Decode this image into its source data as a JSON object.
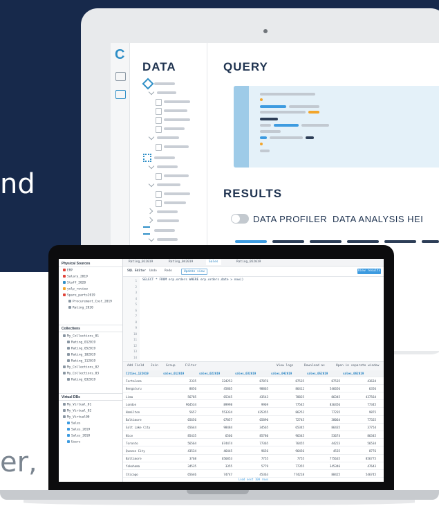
{
  "hero": {
    "left_fragment": "nd",
    "bottom_fragment": "er,"
  },
  "colors": {
    "navy": "#17294b",
    "accent": "#3d9be0",
    "orange": "#f2a52b",
    "teal": "#2f8fc7"
  },
  "tablet": {
    "logo": "C",
    "rail_icons": [
      "book-icon",
      "edit-icon"
    ],
    "data_heading": "DATA",
    "query_heading": "QUERY",
    "results_heading": "RESULTS",
    "data_profiler_label": "DATA PROFILER",
    "data_analysis_label": "DATA ANALYSIS HEI"
  },
  "app": {
    "sidebar": {
      "physical_title": "Physical Sources",
      "physical_items": [
        "ERP",
        "Salary_2019",
        "Staff_2020",
        "yelp_review",
        "Spare_parts2019",
        "Procurement_Cost_2019",
        "Rating_2020"
      ],
      "collections_title": "Collections",
      "collection_items": [
        "My_Collections_01",
        "Rating_012019",
        "Rating_052019",
        "Rating_102019",
        "Rating_112019",
        "My_Collections_02",
        "My_Collections_03",
        "Rating_032019"
      ],
      "virtual_title": "Virtual DBs",
      "virtual_items": [
        "My_Virtual_01",
        "My_Virtual_02",
        "My_Virtual00",
        "Sales",
        "Sales_2019",
        "Sales_2018",
        "Users"
      ]
    },
    "tabs": [
      "Rating_012019",
      "Rating_042019",
      "Sales",
      "Rating_052019"
    ],
    "toolbar": {
      "sql_editor": "SQL Editor",
      "undo": "Undo",
      "redo": "Redo",
      "update_view": "Update view",
      "run": "View results"
    },
    "code": "SELECT * FROM erp.orders WHERE erp.orders.date > now()",
    "line_numbers": [
      "1",
      "2",
      "3",
      "4",
      "5",
      "6",
      "7",
      "8",
      "9",
      "10",
      "11",
      "12",
      "13",
      "14"
    ],
    "results_toolbar": {
      "add_field": "Add Field",
      "join": "Join",
      "group": "Group",
      "filter": "Filter",
      "view_logs": "View logs",
      "download": "Download as",
      "open_separate": "Open in separate window"
    },
    "columns": [
      "Cities_122019",
      "sales_012019",
      "sales_022019",
      "sales_032019",
      "sales_042019",
      "sales_052019",
      "sales_062019"
    ],
    "rows": [
      [
        "Fortaleza",
        "2335",
        "324253",
        "87876",
        "87535",
        "87535",
        "43634"
      ],
      [
        "Bengaluru",
        "8856",
        "45865",
        "98865",
        "86412",
        "546656",
        "6356"
      ],
      [
        "Lima",
        "56785",
        "65345",
        "43543",
        "78825",
        "86345",
        "437564"
      ],
      [
        "London",
        "964534",
        "89998",
        "9969",
        "77545",
        "836456",
        "77345"
      ],
      [
        "Hamilton",
        "5657",
        "553334",
        "435355",
        "86252",
        "77235",
        "9875"
      ],
      [
        "Baltimore",
        "65656",
        "67857",
        "65890",
        "72745",
        "38064",
        "77325"
      ],
      [
        "Salt Lake City",
        "65644",
        "98484",
        "34565",
        "65345",
        "86435",
        "37754"
      ],
      [
        "Nice",
        "85435",
        "6566",
        "85780",
        "96345",
        "53674",
        "86345"
      ],
      [
        "Toronto",
        "56564",
        "674474",
        "77365",
        "76455",
        "44223",
        "56534"
      ],
      [
        "Quezon City",
        "43534",
        "46445",
        "9656",
        "96456",
        "4535",
        "8776"
      ],
      [
        "Baltimore",
        "3768",
        "656853",
        "7755",
        "7755",
        "775635",
        "856775"
      ],
      [
        "Yokohama",
        "34535",
        "3355",
        "5779",
        "77355",
        "345346",
        "47643"
      ],
      [
        "Chicago",
        "65646",
        "74747",
        "45363",
        "774218",
        "88425",
        "546745"
      ]
    ],
    "footer": "Load next 100 rows"
  }
}
